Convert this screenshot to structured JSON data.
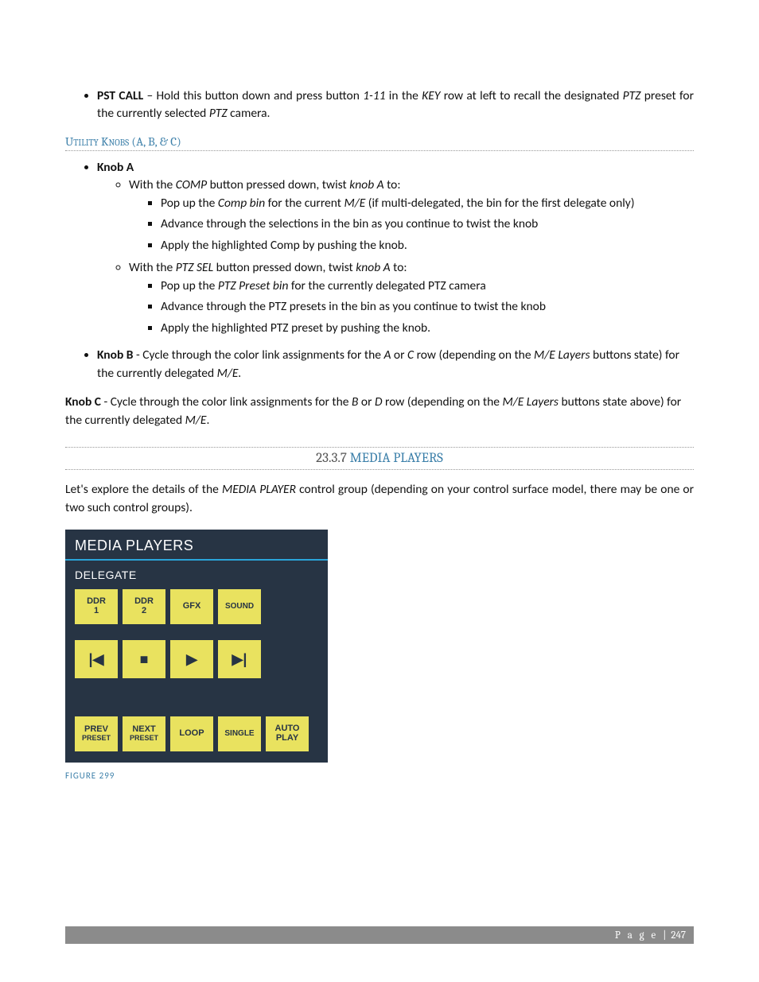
{
  "pst": {
    "label": "PST CALL",
    "text_a": " – Hold this button down and press button ",
    "range": "1-11",
    "text_b": " in the ",
    "key": "KEY",
    "text_c": " row at left to recall the designated ",
    "ptz": "PTZ",
    "text_d": " preset for the currently selected ",
    "text_e": " camera."
  },
  "util_heading": "Utility Knobs (A, B, & C)",
  "knobA": {
    "label": "Knob A",
    "comp_line_a": "With the ",
    "comp": "COMP",
    "comp_line_b": " button pressed down, twist ",
    "knobA_it": "knob A",
    "comp_line_c": " to:",
    "comp_sub1_a": "Pop up the ",
    "comp_bin": "Comp bin",
    "comp_sub1_b": " for the current ",
    "me": "M/E",
    "comp_sub1_c": " (if multi-delegated, the bin for the first delegate only)",
    "comp_sub2": "Advance  through the selections in the bin as you continue to twist the knob",
    "comp_sub3": "Apply the highlighted Comp by pushing the knob.",
    "ptz_line_a": "With the ",
    "ptzsel": "PTZ SEL",
    "ptz_line_b": " button pressed down, twist ",
    "ptz_line_c": " to:",
    "ptz_sub1_a": "Pop up the ",
    "ptz_bin": "PTZ Preset bin",
    "ptz_sub1_b": " for the currently delegated PTZ camera",
    "ptz_sub2": "Advance  through the PTZ presets in the bin as you continue to twist the knob",
    "ptz_sub3": "Apply the highlighted PTZ preset by pushing the knob."
  },
  "knobB": {
    "label": "Knob B",
    "a": " - Cycle through the color link assignments for the ",
    "A": "A",
    "or": " or ",
    "C": "C",
    "b": " row (depending on the ",
    "mel": "M/E Layers",
    "c": " buttons state) for the currently delegated ",
    "me": "M/E.",
    "d": ""
  },
  "knobC": {
    "label": "Knob C",
    "a": " - Cycle through the color link assignments for the ",
    "B": "B",
    "or": " or ",
    "D": "D",
    "b": " row (depending on the ",
    "mel": "M/E Layers",
    "c": " buttons state above) for the currently delegated ",
    "me": "M/E",
    "d": "."
  },
  "section": {
    "num": "23.3.7",
    "title": " MEDIA PLAYERS"
  },
  "intro": {
    "a": "Let's explore the details of the ",
    "mp": "MEDIA PLAYER",
    "b": " control group (depending on your control surface model, there may be one or two such control groups)."
  },
  "panel": {
    "title": "MEDIA PLAYERS",
    "delegate": "DELEGATE",
    "ddr1a": "DDR",
    "ddr1b": "1",
    "ddr2a": "DDR",
    "ddr2b": "2",
    "gfx": "GFX",
    "sound": "SOUND",
    "prev": "|◀",
    "stop": "■",
    "play": "▶",
    "next": "▶|",
    "prev_pa": "PREV",
    "prev_pb": "PRESET",
    "next_pa": "NEXT",
    "next_pb": "PRESET",
    "loop": "LOOP",
    "single": "SINGLE",
    "autoa": "AUTO",
    "autob": "PLAY"
  },
  "figure": "FIGURE 299",
  "footer": {
    "page": "P a g e",
    "bar": "|",
    "num": "247"
  }
}
